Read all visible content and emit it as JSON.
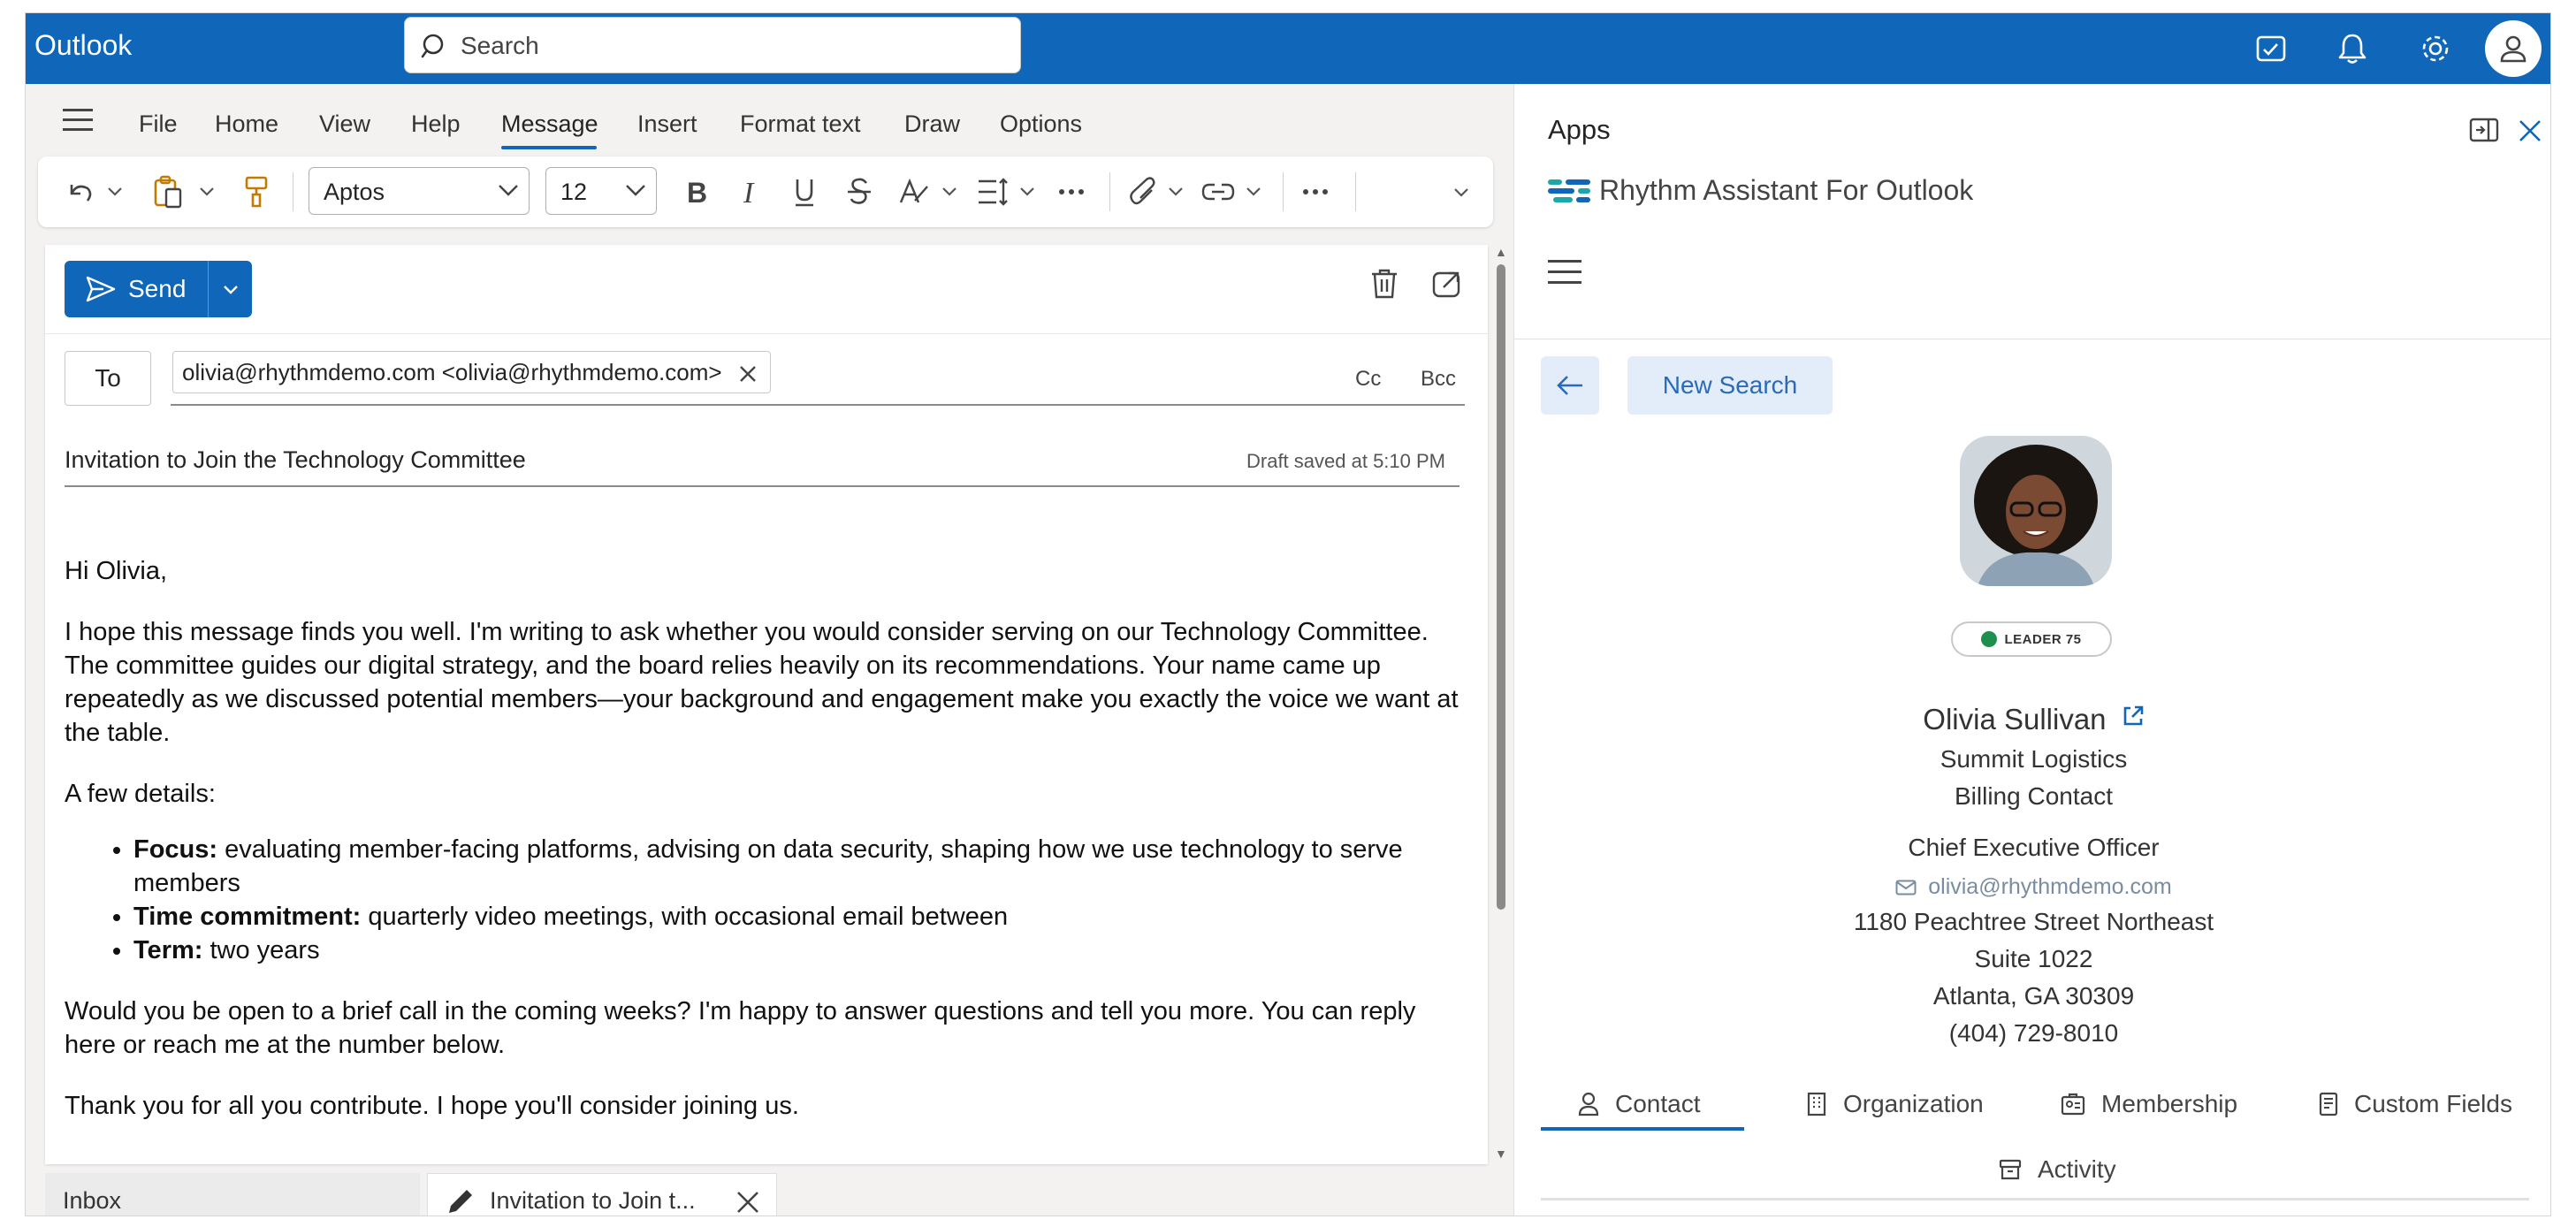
{
  "app": {
    "brand": "Outlook"
  },
  "search": {
    "placeholder": "Search"
  },
  "ribbon": {
    "menu": [
      "File",
      "Home",
      "View",
      "Help",
      "Message",
      "Insert",
      "Format text",
      "Draw",
      "Options"
    ],
    "active_menu": "Message",
    "font_name": "Aptos",
    "font_size": "12"
  },
  "compose": {
    "send_label": "Send",
    "to_label": "To",
    "recipient": "olivia@rhythmdemo.com <olivia@rhythmdemo.com>",
    "cc_label": "Cc",
    "bcc_label": "Bcc",
    "subject": "Invitation to Join the Technology Committee",
    "draft_status": "Draft saved at 5:10 PM",
    "greeting": "Hi Olivia,",
    "para1": "I hope this message finds you well. I'm writing to ask whether you would consider serving on our Technology Committee. The committee guides our digital strategy, and the board relies heavily on its recommendations. Your name came up repeatedly as we discussed potential members—your background and engagement make you exactly the voice we want at the table.",
    "details_intro": "A few details:",
    "details": [
      {
        "label": "Focus:",
        "text": " evaluating member-facing platforms, advising on data security, shaping how we use technology to serve members"
      },
      {
        "label": "Time commitment:",
        "text": " quarterly video meetings, with occasional email between"
      },
      {
        "label": "Term:",
        "text": " two years"
      }
    ],
    "para2": "Would you be open to a brief call in the coming weeks? I'm happy to answer questions and tell you more. You can reply here or reach me at the number below.",
    "para3": "Thank you for all you contribute. I hope you'll consider joining us."
  },
  "bottom_tabs": {
    "inbox": "Inbox",
    "draft": "Invitation to Join t..."
  },
  "apps_panel": {
    "title": "Apps",
    "addin_name": "Rhythm Assistant For Outlook",
    "new_search_label": "New Search",
    "badge": "LEADER 75",
    "badge_color": "#1f8f4e",
    "contact": {
      "name": "Olivia Sullivan",
      "organization": "Summit Logistics",
      "role": "Billing Contact",
      "title": "Chief Executive Officer",
      "email": "olivia@rhythmdemo.com",
      "address1": "1180 Peachtree Street Northeast",
      "address2": "Suite 1022",
      "city_line": "Atlanta, GA 30309",
      "phone": "(404) 729-8010"
    },
    "tabs": [
      "Contact",
      "Organization",
      "Membership",
      "Custom Fields",
      "Activity"
    ],
    "active_tab": "Contact"
  },
  "colors": {
    "accent": "#1066b8",
    "rhythm_brand": "#1ea7a8"
  }
}
